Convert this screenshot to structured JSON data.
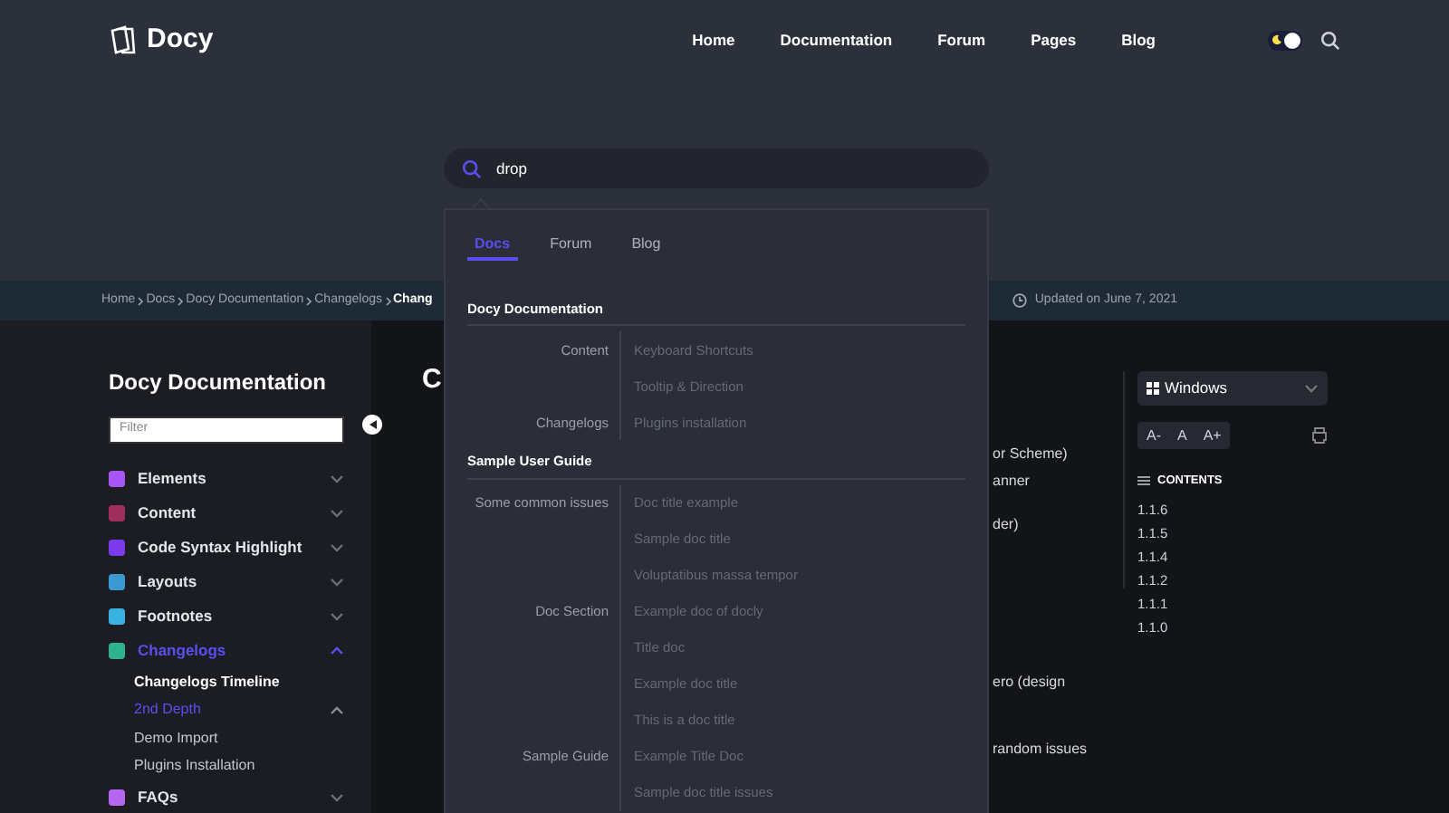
{
  "header": {
    "logo": "Docy",
    "nav": [
      {
        "label": "Home"
      },
      {
        "label": "Documentation"
      },
      {
        "label": "Forum"
      },
      {
        "label": "Pages"
      },
      {
        "label": "Blog"
      }
    ],
    "dark_mode": true
  },
  "search": {
    "value": "drop"
  },
  "breadcrumb": {
    "items": [
      "Home",
      "Docs",
      "Docy Documentation",
      "Changelogs",
      "Chang"
    ],
    "updated": "Updated on June 7, 2021"
  },
  "sidebar": {
    "title": "Docy Documentation",
    "filter_placeholder": "Filter",
    "items": [
      {
        "label": "Elements",
        "color": "#a855f7",
        "expanded": false,
        "selected": false
      },
      {
        "label": "Content",
        "color": "#9d2f5a",
        "expanded": false,
        "selected": false
      },
      {
        "label": "Code Syntax Highlight",
        "color": "#7c3aed",
        "expanded": false,
        "selected": false
      },
      {
        "label": "Layouts",
        "color": "#3b9bd1",
        "expanded": false,
        "selected": false
      },
      {
        "label": "Footnotes",
        "color": "#38b2e0",
        "expanded": false,
        "selected": false
      },
      {
        "label": "Changelogs",
        "color": "#2fb38c",
        "expanded": true,
        "selected": true,
        "children": [
          {
            "label": "Changelogs Timeline",
            "selected": true,
            "expanded": false
          },
          {
            "label": "2nd Depth",
            "selected": false,
            "expanded": true
          },
          {
            "label": "Demo Import",
            "selected": false,
            "expanded": false
          },
          {
            "label": "Plugins Installation",
            "selected": false,
            "expanded": false
          }
        ]
      },
      {
        "label": "FAQs",
        "color": "#b667f1",
        "expanded": false,
        "selected": false
      }
    ]
  },
  "article": {
    "heading": "C",
    "fragments": [
      {
        "text": "or Scheme)"
      },
      {
        "text": "anner"
      },
      {
        "text": "der)"
      },
      {
        "text": "ero (design"
      },
      {
        "text": "random issues"
      }
    ]
  },
  "right_panel": {
    "os_select": "Windows",
    "font_buttons": [
      "A-",
      "A",
      "A+"
    ],
    "contents_title": "CONTENTS",
    "contents": [
      "1.1.6",
      "1.1.5",
      "1.1.4",
      "1.1.2",
      "1.1.1",
      "1.1.0"
    ]
  },
  "dropdown": {
    "tabs": [
      {
        "label": "Docs",
        "selected": true
      },
      {
        "label": "Forum",
        "selected": false
      },
      {
        "label": "Blog",
        "selected": false
      }
    ],
    "groups": [
      {
        "title": "Docy Documentation",
        "rows": [
          {
            "category": "Content",
            "title": "Keyboard Shortcuts"
          },
          {
            "title": "Tooltip & Direction"
          },
          {
            "category": "Changelogs",
            "title": "Plugins installation"
          }
        ]
      },
      {
        "title": "Sample User Guide",
        "rows": [
          {
            "category": "Some common issues",
            "title": "Doc title example"
          },
          {
            "title": "Sample doc title"
          },
          {
            "title": "Voluptatibus massa tempor"
          },
          {
            "category": "Doc Section",
            "title": "Example doc of docly"
          },
          {
            "title": "Title doc"
          },
          {
            "title": "Example doc title"
          },
          {
            "title": "This is a doc title"
          },
          {
            "category": "Sample Guide",
            "title": "Example Title Doc"
          },
          {
            "title": "Sample doc title issues"
          }
        ]
      }
    ]
  }
}
